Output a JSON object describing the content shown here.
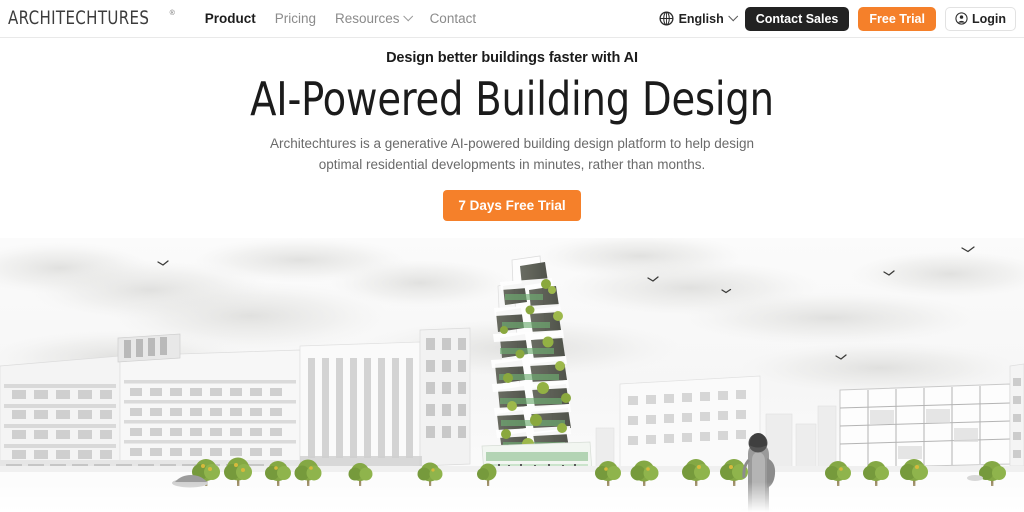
{
  "header": {
    "logo": {
      "text": "ARCHITECHTURES",
      "trademark": "®",
      "icon": "logo-wordmark"
    },
    "nav": [
      {
        "label": "Product",
        "active": true,
        "has_dropdown": false
      },
      {
        "label": "Pricing",
        "active": false,
        "has_dropdown": false
      },
      {
        "label": "Resources",
        "active": false,
        "has_dropdown": true
      },
      {
        "label": "Contact",
        "active": false,
        "has_dropdown": false
      }
    ],
    "language": {
      "label": "English",
      "icon": "globe-icon",
      "has_dropdown": true
    },
    "contact_sales_label": "Contact Sales",
    "free_trial_label": "Free Trial",
    "login_label": "Login",
    "login_icon": "user-circle-icon"
  },
  "hero": {
    "eyebrow": "Design better buildings faster with AI",
    "headline": "AI-Powered Building Design",
    "subtitle": "Architechtures is a generative AI-powered building design platform to help design optimal residential developments in minutes, rather than months.",
    "cta_label": "7 Days Free Trial",
    "image_alt": "Architectural rendering of a modular green-terraced tower in a white residential district with trees, pedestrians and birds"
  },
  "colors": {
    "accent_orange": "#F5802A",
    "dark_button": "#222222",
    "text_dark": "#1b1b1b",
    "text_muted": "#6a6a6a",
    "nav_muted": "#8b8b8b",
    "border": "#e9e9e9",
    "foliage_green": "#7a9c3f",
    "fruit_accent": "#d8b33a"
  }
}
